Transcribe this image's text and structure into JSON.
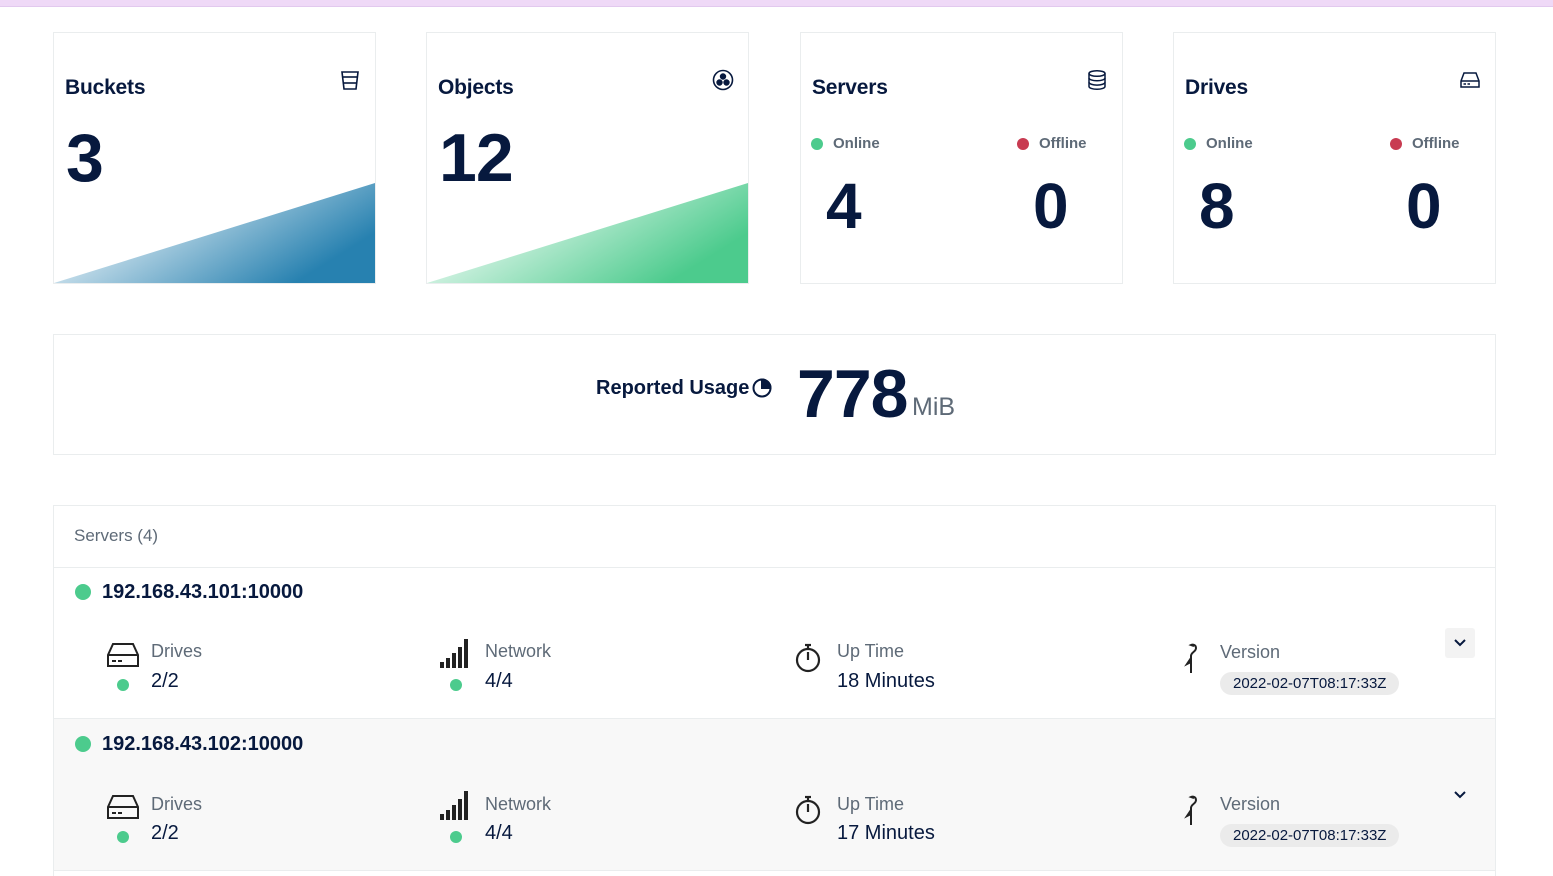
{
  "cards": {
    "buckets": {
      "title": "Buckets",
      "value": "3",
      "icon": "bucket-icon"
    },
    "objects": {
      "title": "Objects",
      "value": "12",
      "icon": "objects-icon"
    },
    "servers": {
      "title": "Servers",
      "online_label": "Online",
      "offline_label": "Offline",
      "online": "4",
      "offline": "0",
      "icon": "database-icon"
    },
    "drives": {
      "title": "Drives",
      "online_label": "Online",
      "offline_label": "Offline",
      "online": "8",
      "offline": "0",
      "icon": "drive-icon"
    }
  },
  "usage": {
    "label": "Reported Usage",
    "value": "778",
    "unit": "MiB",
    "icon": "pie-chart-icon"
  },
  "servers_panel": {
    "title": "Servers (4)",
    "items": [
      {
        "address": "192.168.43.101:10000",
        "drives_label": "Drives",
        "drives": "2/2",
        "network_label": "Network",
        "network": "4/4",
        "uptime_label": "Up Time",
        "uptime": "18 Minutes",
        "version_label": "Version",
        "version": "2022-02-07T08:17:33Z"
      },
      {
        "address": "192.168.43.102:10000",
        "drives_label": "Drives",
        "drives": "2/2",
        "network_label": "Network",
        "network": "4/4",
        "uptime_label": "Up Time",
        "uptime": "17 Minutes",
        "version_label": "Version",
        "version": "2022-02-07T08:17:33Z"
      }
    ]
  },
  "colors": {
    "online": "#4ccb8d",
    "offline": "#c83b51",
    "text_dark": "#07193e",
    "buckets_accent": "#2781b0",
    "objects_accent": "#4ccb8d"
  }
}
